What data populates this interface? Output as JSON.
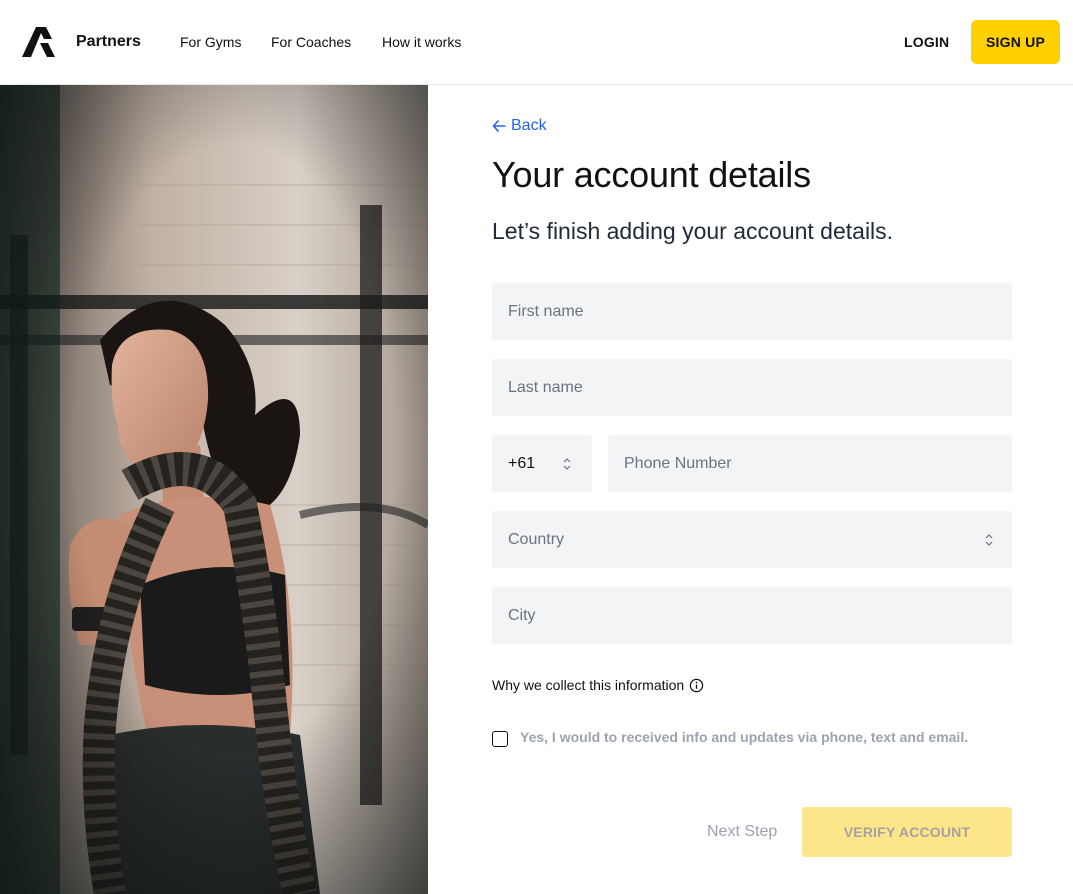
{
  "header": {
    "brand": "Partners",
    "nav": [
      "For Gyms",
      "For Coaches",
      "How it works"
    ],
    "login_label": "LOGIN",
    "signup_label": "SIGN UP"
  },
  "form": {
    "back_label": "Back",
    "title": "Your account details",
    "subtitle": "Let’s finish adding your account details.",
    "first_name_placeholder": "First name",
    "last_name_placeholder": "Last name",
    "country_code": "+61",
    "phone_placeholder": "Phone Number",
    "country_placeholder": "Country",
    "city_placeholder": "City",
    "why_label": "Why we collect this information",
    "consent_label": "Yes, I would to received info and updates via phone, text and email.",
    "consent_checked": false,
    "next_step_label": "Next Step",
    "verify_label": "VERIFY ACCOUNT"
  },
  "colors": {
    "accent": "#ffd000",
    "accent_disabled": "#fde68a",
    "link": "#2563eb",
    "field_bg": "#f3f4f6"
  },
  "icons": {
    "logo": "brand-logo-icon",
    "back": "arrow-left-icon",
    "select": "chevron-up-down-icon",
    "info": "info-circle-icon"
  }
}
